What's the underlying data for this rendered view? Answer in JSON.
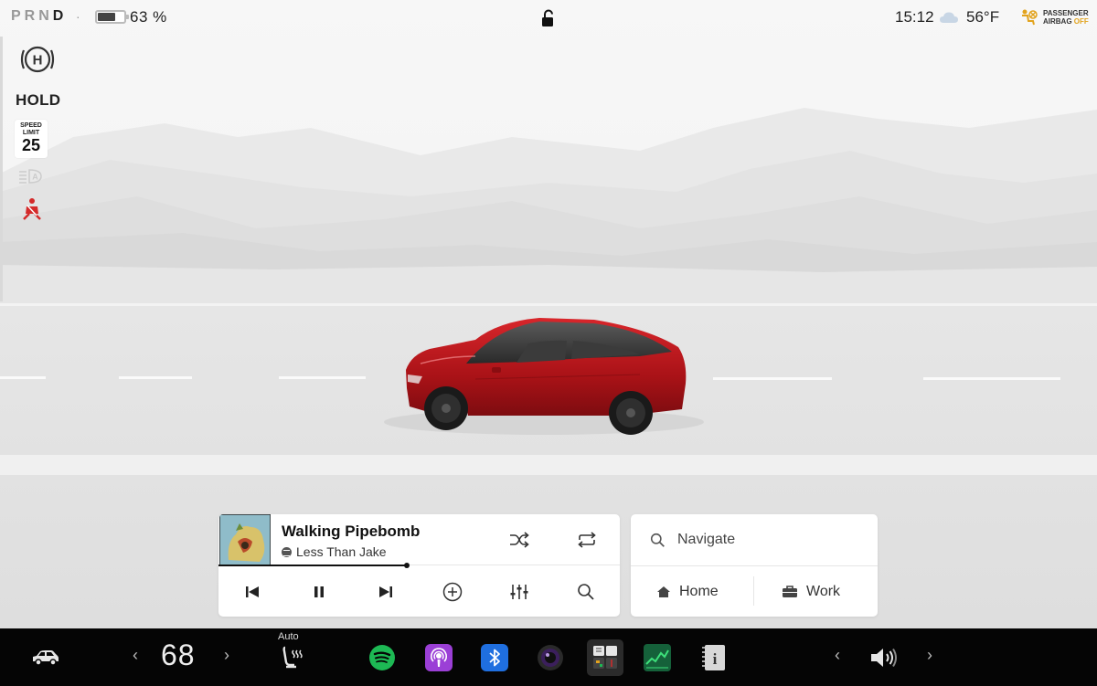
{
  "status": {
    "gears": [
      "P",
      "R",
      "N",
      "D"
    ],
    "active_gear": "D",
    "battery_percent": "63 %",
    "battery_level": 0.63,
    "time": "15:12",
    "temperature": "56°F",
    "airbag_line1": "PASSENGER",
    "airbag_line2": "AIRBAG",
    "airbag_state": "OFF"
  },
  "indicators": {
    "hold_label": "HOLD",
    "speed_limit_label_1": "SPEED",
    "speed_limit_label_2": "LIMIT",
    "speed_limit_value": "25"
  },
  "media": {
    "track_title": "Walking Pipebomb",
    "artist": "Less Than Jake",
    "progress": 0.47
  },
  "navigation": {
    "search_placeholder": "Navigate",
    "home_label": "Home",
    "work_label": "Work"
  },
  "dock": {
    "cabin_temp": "68",
    "seat_heater_mode": "Auto"
  },
  "colors": {
    "car_red": "#b3151a",
    "airbag_off": "#e2a31d",
    "seatbelt_warning": "#d42a2a",
    "spotify_green": "#1db954",
    "podcasts_purple": "#9b3fd6",
    "bluetooth_blue": "#1f6fe0"
  },
  "icons": [
    "hold-icon",
    "auto-high-beam-icon",
    "seatbelt-warning-icon",
    "lock-icon",
    "cloud-icon",
    "airbag-icon",
    "shuffle-icon",
    "repeat-icon",
    "previous-icon",
    "pause-icon",
    "next-icon",
    "add-icon",
    "equalizer-icon",
    "search-icon",
    "home-icon",
    "briefcase-icon",
    "car-icon",
    "seat-heater-icon",
    "spotify-icon",
    "podcasts-icon",
    "bluetooth-icon",
    "camera-icon",
    "toybox-icon",
    "stocks-icon",
    "manual-icon",
    "volume-icon"
  ]
}
